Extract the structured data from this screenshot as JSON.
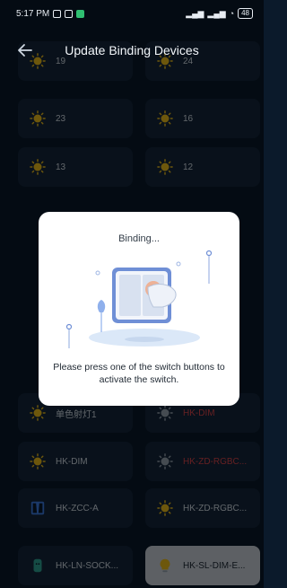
{
  "status": {
    "time": "5:17 PM",
    "signal1": "▂▄▆",
    "signal2": "▂▄▆",
    "wifi": "◔",
    "battery": "48"
  },
  "header": {
    "title": "Update Binding Devices"
  },
  "devices": [
    {
      "label": "19",
      "icon": "bulb-icon",
      "state": "normal"
    },
    {
      "label": "24",
      "icon": "bulb-icon",
      "state": "normal"
    },
    {
      "label": "23",
      "icon": "bulb-icon",
      "state": "normal"
    },
    {
      "label": "16",
      "icon": "bulb-icon",
      "state": "normal"
    },
    {
      "label": "13",
      "icon": "bulb-icon",
      "state": "normal"
    },
    {
      "label": "12",
      "icon": "bulb-icon",
      "state": "normal"
    },
    {
      "label": "单色射灯1",
      "icon": "bulb-icon",
      "state": "normal"
    },
    {
      "label": "HK-DIM",
      "icon": "bulb-icon",
      "state": "offline"
    },
    {
      "label": "HK-DIM",
      "icon": "bulb-icon",
      "state": "normal"
    },
    {
      "label": "HK-ZD-RGBC...",
      "icon": "bulb-icon",
      "state": "offline"
    },
    {
      "label": "HK-ZCC-A",
      "icon": "curtain-icon",
      "state": "normal"
    },
    {
      "label": "HK-ZD-RGBC...",
      "icon": "bulb-icon",
      "state": "normal"
    },
    {
      "label": "HK-LN-SOCK...",
      "icon": "socket-icon",
      "state": "normal"
    },
    {
      "label": "HK-SL-DIM-E...",
      "icon": "bulb-icon",
      "state": "selected"
    }
  ],
  "dialog": {
    "title": "Binding...",
    "message": "Please press one of the switch buttons to activate the switch."
  },
  "colors": {
    "accent": "#f2c21b",
    "offline": "#e0474c",
    "background": "#0b1a2b",
    "card": "#14273c"
  }
}
